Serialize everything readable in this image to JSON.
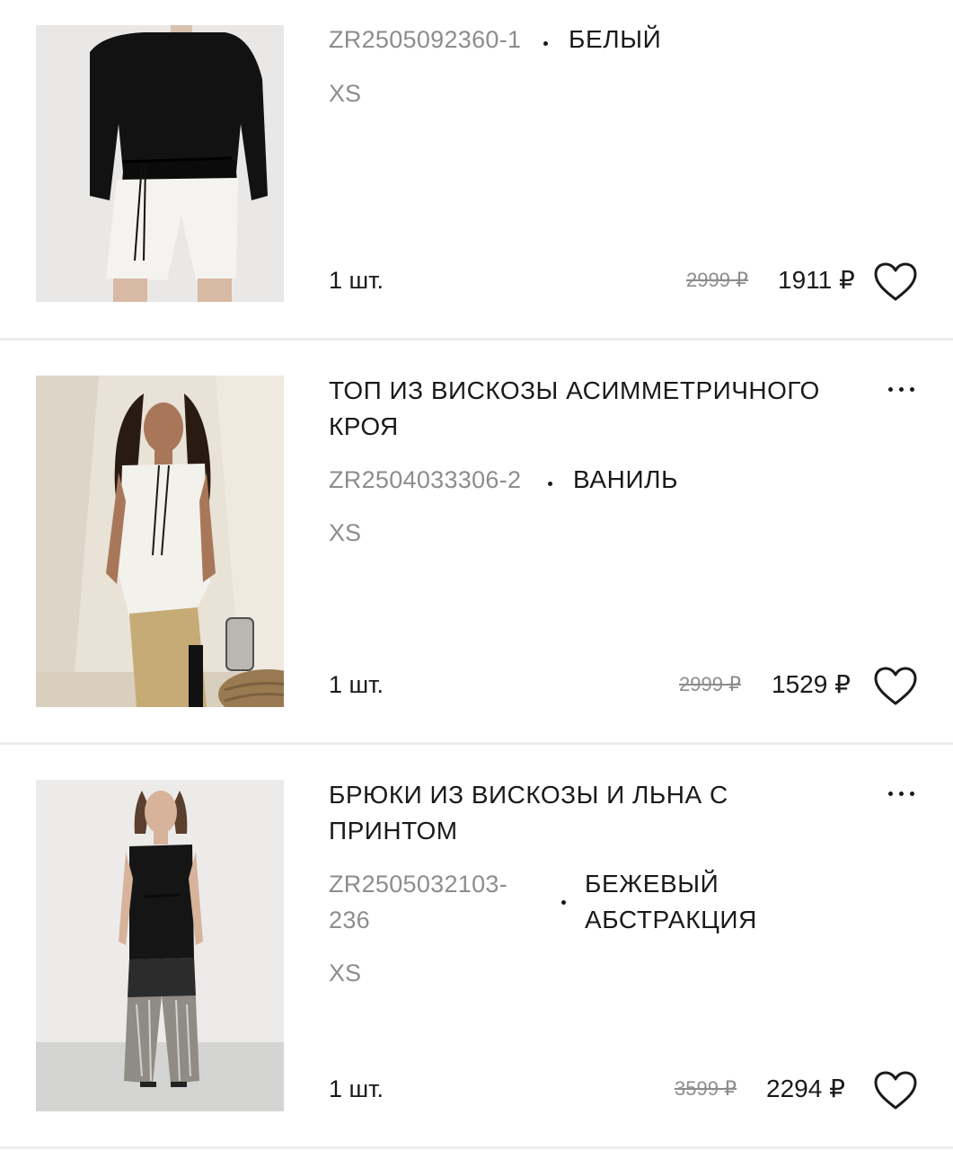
{
  "items": [
    {
      "title": "",
      "sku": "ZR2505092360-1",
      "color": "БЕЛЫЙ",
      "size": "XS",
      "quantity": "1 шт.",
      "old_price": "2999 ₽",
      "price": "1911 ₽"
    },
    {
      "title": "ТОП ИЗ ВИСКОЗЫ АСИММЕТРИЧНОГО КРОЯ",
      "sku": "ZR2504033306-2",
      "color": "ВАНИЛЬ",
      "size": "XS",
      "quantity": "1 шт.",
      "old_price": "2999 ₽",
      "price": "1529 ₽"
    },
    {
      "title": "БРЮКИ ИЗ ВИСКОЗЫ И ЛЬНА С ПРИНТОМ",
      "sku": "ZR2505032103-236",
      "sku_line1": "ZR2505032103-",
      "sku_line2": "236",
      "color": "БЕЖЕВЫЙ АБСТРАКЦИЯ",
      "color_line1": "БЕЖЕВЫЙ",
      "color_line2": "АБСТРАКЦИЯ",
      "size": "XS",
      "quantity": "1 шт.",
      "old_price": "3599 ₽",
      "price": "2294 ₽"
    }
  ],
  "icons": {
    "favorite": "heart-outline-icon",
    "more": "more-horizontal-icon"
  }
}
